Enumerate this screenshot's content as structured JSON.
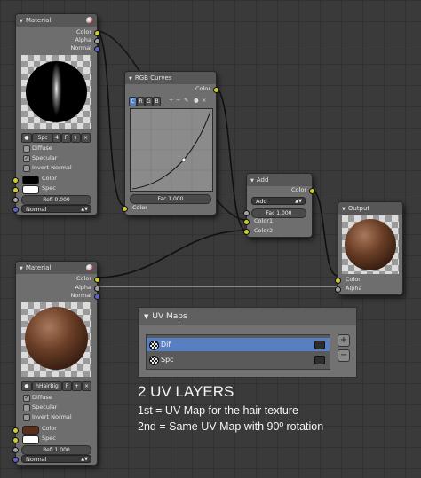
{
  "material_node_1": {
    "title": "Material",
    "outputs": [
      "Color",
      "Alpha",
      "Normal"
    ],
    "material_name": "Spc",
    "user_count": "4",
    "f_label": "F",
    "checks": [
      {
        "label": "Diffuse",
        "checked": false
      },
      {
        "label": "Specular",
        "checked": true
      },
      {
        "label": "Invert Normal",
        "checked": false
      }
    ],
    "inputs": [
      "Color",
      "Spec",
      "Refl 0.000",
      "Normal"
    ],
    "input_colors": [
      "#000000",
      "#ffffff"
    ]
  },
  "rgb_curves_node": {
    "title": "RGB Curves",
    "output": "Color",
    "channels": [
      "C",
      "R",
      "G",
      "B"
    ],
    "fac_field": "Fac 1.000",
    "input": "Color"
  },
  "add_node": {
    "title": "Add",
    "output": "Color",
    "blend_mode": "Add",
    "fac_field": "Fac 1.000",
    "inputs": [
      "Color1",
      "Color2"
    ]
  },
  "output_node": {
    "title": "Output",
    "inputs": [
      "Color",
      "Alpha"
    ]
  },
  "material_node_2": {
    "title": "Material",
    "outputs": [
      "Color",
      "Alpha",
      "Normal"
    ],
    "material_name": "hHairBig",
    "f_label": "F",
    "checks": [
      {
        "label": "Diffuse",
        "checked": true
      },
      {
        "label": "Specular",
        "checked": false
      },
      {
        "label": "Invert Normal",
        "checked": false
      }
    ],
    "inputs": [
      "Color",
      "Spec",
      "Refl 1.000",
      "Normal"
    ],
    "input_colors": [
      "#5a2e1a",
      "#ffffff"
    ]
  },
  "uv_maps_panel": {
    "title": "UV Maps",
    "items": [
      "Dif",
      "Spc"
    ],
    "selected_index": 0
  },
  "caption": {
    "heading": "2 UV LAYERS",
    "line1": "1st = UV Map for the hair texture",
    "line2": "2nd = Same UV Map with 90º rotation"
  },
  "colors": {
    "socket_color": "#cccc33",
    "socket_float": "#a3a3a3",
    "socket_vector": "#6363c7",
    "selected_uv": "#5680c2"
  }
}
